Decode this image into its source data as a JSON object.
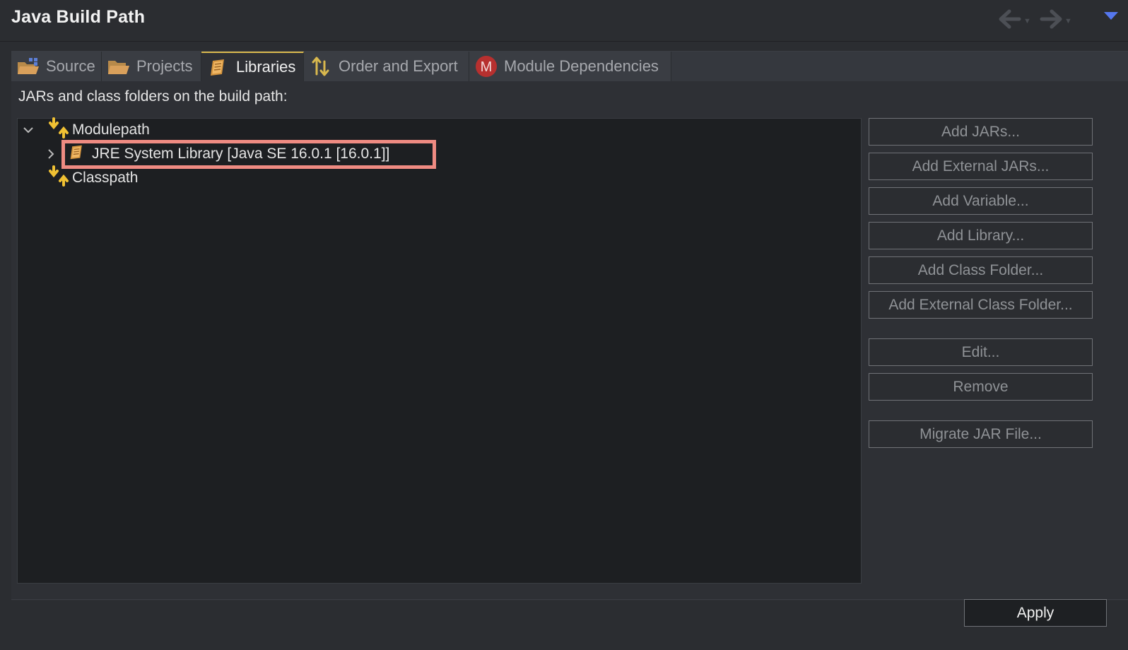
{
  "window": {
    "title": "Java Build Path"
  },
  "tabs": [
    {
      "label": "Source",
      "icon": "source-folder-icon"
    },
    {
      "label": "Projects",
      "icon": "projects-folder-icon"
    },
    {
      "label": "Libraries",
      "icon": "library-icon",
      "active": true
    },
    {
      "label": "Order and Export",
      "icon": "order-export-icon"
    },
    {
      "label": "Module Dependencies",
      "icon": "module-m-icon"
    }
  ],
  "panel": {
    "heading": "JARs and class folders on the build path:"
  },
  "tree": {
    "modulepath": "Modulepath",
    "jre": "JRE System Library [Java SE 16.0.1 [16.0.1]]",
    "classpath": "Classpath"
  },
  "buttons": {
    "add_jars": "Add JARs...",
    "add_external_jars": "Add External JARs...",
    "add_variable": "Add Variable...",
    "add_library": "Add Library...",
    "add_class_folder": "Add Class Folder...",
    "add_external_class_folder": "Add External Class Folder...",
    "edit": "Edit...",
    "remove": "Remove",
    "migrate_jar": "Migrate JAR File...",
    "apply": "Apply"
  },
  "colors": {
    "accent_tab": "#d8b84e",
    "highlight_box": "#ef8b82",
    "menu_arrow": "#5577ee"
  }
}
